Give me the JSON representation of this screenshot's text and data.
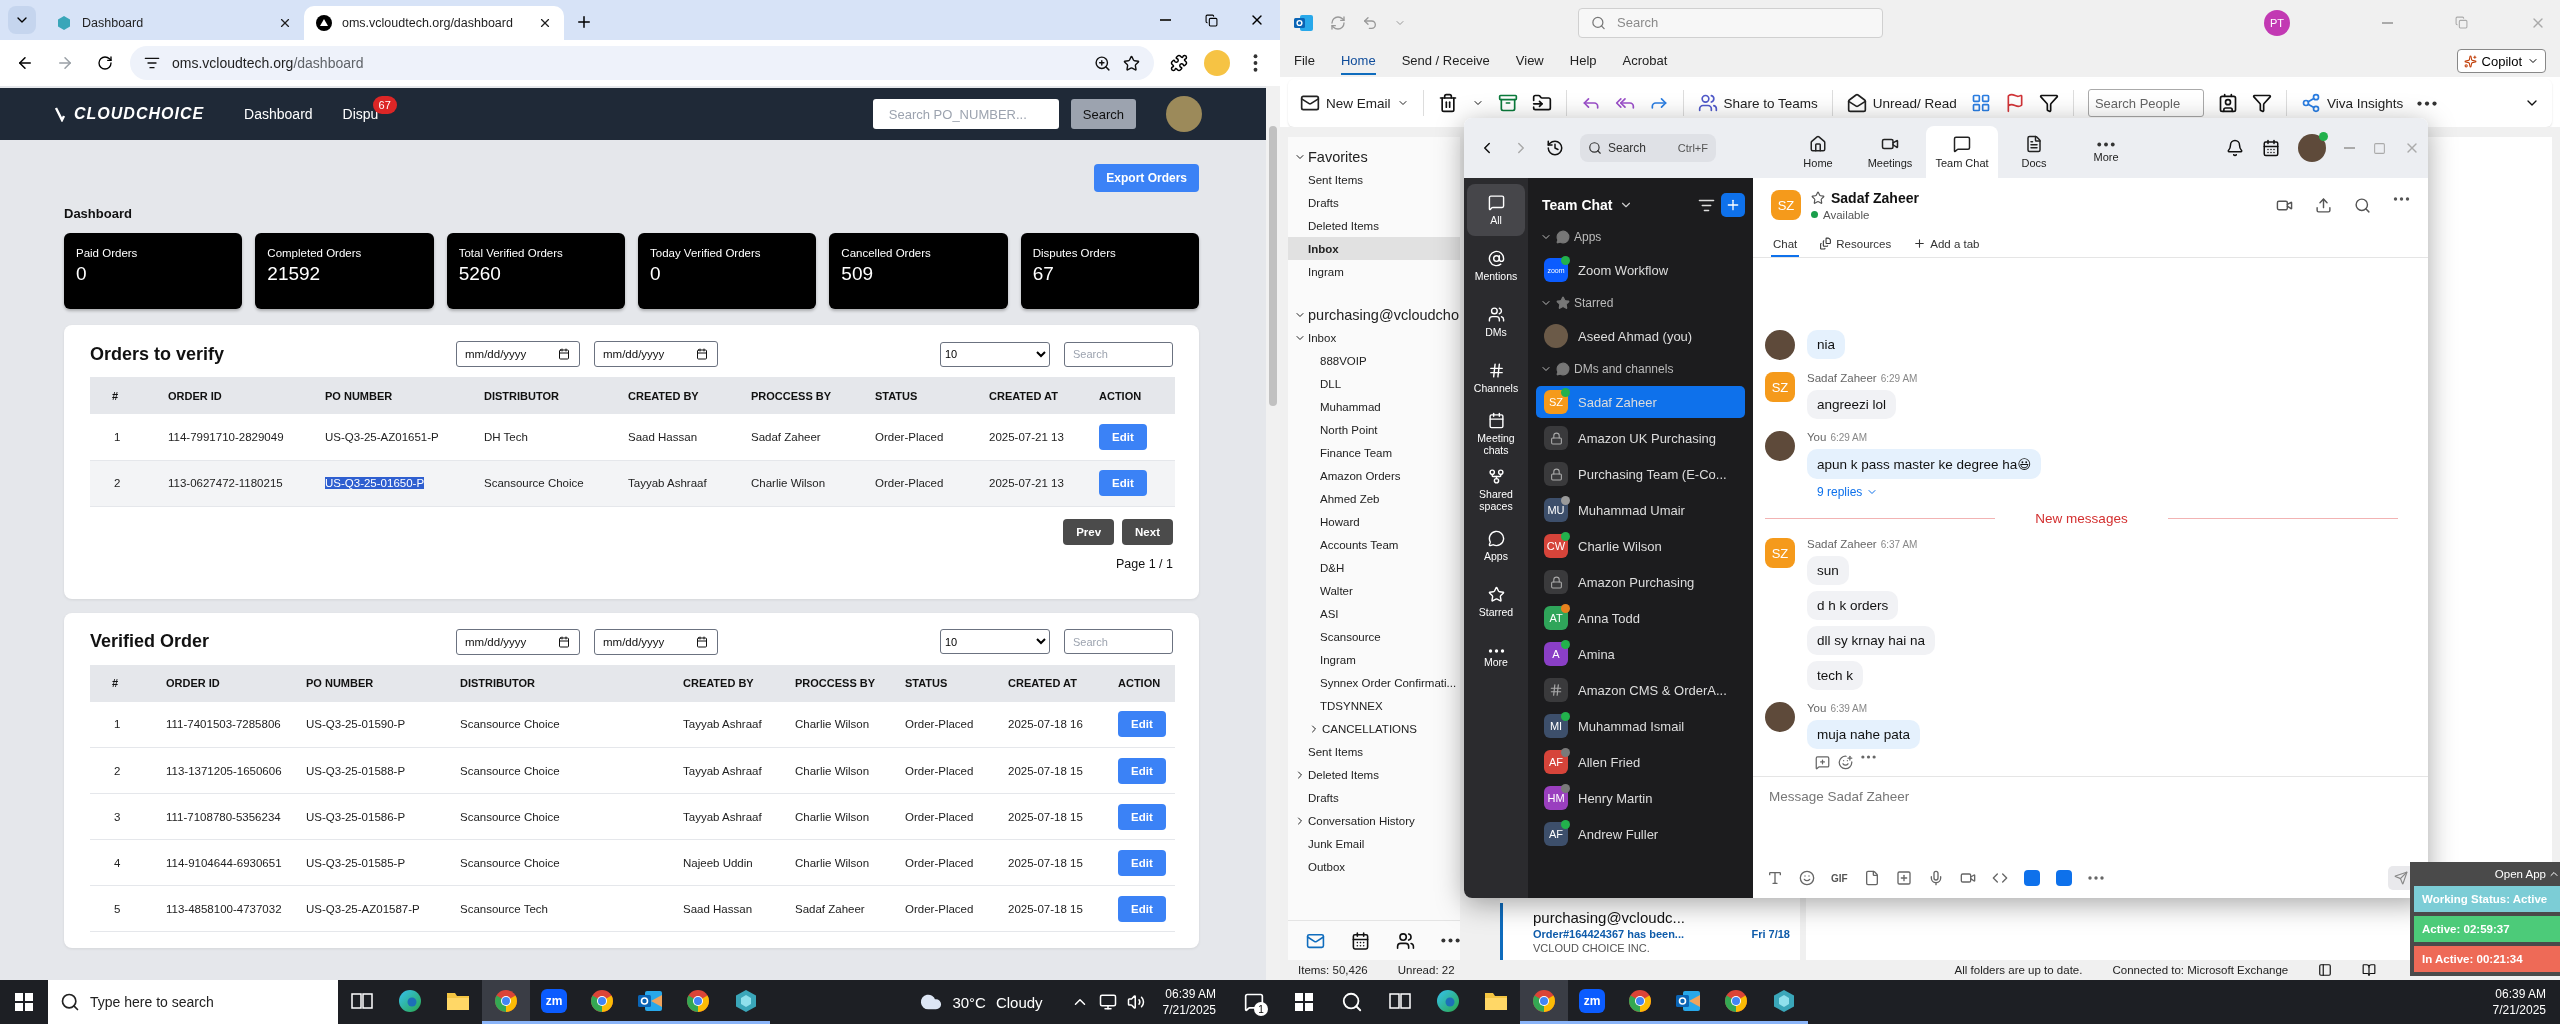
{
  "left_monitor": {
    "browser": {
      "tabs": [
        {
          "title": "Dashboard",
          "selected": false
        },
        {
          "title": "oms.vcloudtech.org/dashboard",
          "selected": true
        }
      ],
      "address": {
        "host": "oms.vcloudtech.org",
        "path": "/dashboard"
      }
    },
    "site": {
      "navbar": {
        "logo": "CLOUDCHOICE",
        "links": [
          {
            "label": "Dashboard"
          },
          {
            "label": "Dispu",
            "badge": "67"
          }
        ],
        "search_placeholder": "Search PO_NUMBER...",
        "search_button": "Search"
      },
      "export_button": "Export Orders",
      "heading": "Dashboard",
      "stats": [
        {
          "label": "Paid Orders",
          "value": "0"
        },
        {
          "label": "Completed Orders",
          "value": "21592"
        },
        {
          "label": "Total Verified Orders",
          "value": "5260"
        },
        {
          "label": "Today Verified Orders",
          "value": "0"
        },
        {
          "label": "Cancelled Orders",
          "value": "509"
        },
        {
          "label": "Disputes Orders",
          "value": "67"
        }
      ],
      "tables": [
        {
          "title": "Orders to verify",
          "date_placeholders": [
            "mm/dd/yyyy",
            "mm/dd/yyyy"
          ],
          "page_size": "10",
          "search_placeholder": "Search",
          "columns": [
            "#",
            "ORDER ID",
            "PO NUMBER",
            "DISTRIBUTOR",
            "CREATED BY",
            "PROCCESS BY",
            "STATUS",
            "CREATED AT",
            "ACTION"
          ],
          "rows": [
            {
              "cells": [
                "1",
                "114-7991710-2829049",
                "US-Q3-25-AZ01651-P",
                "DH Tech",
                "Saad Hassan",
                "Sadaf Zaheer",
                "Order-Placed",
                "2025-07-21 13"
              ],
              "action": "Edit",
              "po_highlighted": false
            },
            {
              "cells": [
                "2",
                "113-0627472-1180215",
                "US-Q3-25-01650-P",
                "Scansource Choice",
                "Tayyab Ashraaf",
                "Charlie Wilson",
                "Order-Placed",
                "2025-07-21 13"
              ],
              "action": "Edit",
              "po_highlighted": true
            }
          ],
          "pagination": {
            "prev": "Prev",
            "next": "Next",
            "page": "Page 1 / 1"
          }
        },
        {
          "title": "Verified Order",
          "date_placeholders": [
            "mm/dd/yyyy",
            "mm/dd/yyyy"
          ],
          "page_size": "10",
          "search_placeholder": "Search",
          "columns": [
            "#",
            "ORDER ID",
            "PO NUMBER",
            "DISTRIBUTOR",
            "CREATED BY",
            "PROCCESS BY",
            "STATUS",
            "CREATED AT",
            "ACTION"
          ],
          "rows": [
            {
              "cells": [
                "1",
                "111-7401503-7285806",
                "US-Q3-25-01590-P",
                "Scansource Choice",
                "Tayyab Ashraaf",
                "Charlie Wilson",
                "Order-Placed",
                "2025-07-18 16"
              ],
              "action": "Edit",
              "po_highlighted": false
            },
            {
              "cells": [
                "2",
                "113-1371205-1650606",
                "US-Q3-25-01588-P",
                "Scansource Choice",
                "Tayyab Ashraaf",
                "Charlie Wilson",
                "Order-Placed",
                "2025-07-18 15"
              ],
              "action": "Edit",
              "po_highlighted": false
            },
            {
              "cells": [
                "3",
                "111-7108780-5356234",
                "US-Q3-25-01586-P",
                "Scansource Choice",
                "Tayyab Ashraaf",
                "Charlie Wilson",
                "Order-Placed",
                "2025-07-18 15"
              ],
              "action": "Edit",
              "po_highlighted": false
            },
            {
              "cells": [
                "4",
                "114-9104644-6930651",
                "US-Q3-25-01585-P",
                "Scansource Choice",
                "Najeeb Uddin",
                "Charlie Wilson",
                "Order-Placed",
                "2025-07-18 15"
              ],
              "action": "Edit",
              "po_highlighted": false
            },
            {
              "cells": [
                "5",
                "113-4858100-4737032",
                "US-Q3-25-AZ01587-P",
                "Scansource Tech",
                "Saad Hassan",
                "Sadaf Zaheer",
                "Order-Placed",
                "2025-07-18 15"
              ],
              "action": "Edit",
              "po_highlighted": false
            }
          ]
        }
      ]
    },
    "taskbar": {
      "search_placeholder": "Type here to search",
      "apps": [
        {
          "kind": "taskview",
          "open": false,
          "focused": false
        },
        {
          "kind": "edge",
          "open": false,
          "focused": false
        },
        {
          "kind": "explorer",
          "open": false,
          "focused": false
        },
        {
          "kind": "chrome",
          "open": true,
          "focused": true
        },
        {
          "kind": "zoom",
          "label": "zm",
          "open": true,
          "focused": false
        },
        {
          "kind": "chrome",
          "open": true,
          "focused": false
        },
        {
          "kind": "outlook",
          "open": true,
          "focused": false
        },
        {
          "kind": "chrome",
          "open": true,
          "focused": false
        },
        {
          "kind": "hexagon",
          "open": true,
          "focused": false
        }
      ],
      "temperature": "30°C",
      "weather": "Cloudy",
      "time": "06:39 AM",
      "date": "7/21/2025",
      "notifications": "1"
    }
  },
  "right_monitor": {
    "outlook": {
      "search_placeholder": "Search",
      "account_initials": "PT",
      "menu": [
        {
          "label": "File",
          "selected": false
        },
        {
          "label": "Home",
          "selected": true
        },
        {
          "label": "Send / Receive",
          "selected": false
        },
        {
          "label": "View",
          "selected": false
        },
        {
          "label": "Help",
          "selected": false
        },
        {
          "label": "Acrobat",
          "selected": false
        }
      ],
      "copilot": "Copilot",
      "ribbon": {
        "new_email": "New Email",
        "share_to_teams": "Share to Teams",
        "unread_read": "Unread/ Read",
        "search_people_placeholder": "Search People",
        "viva_insights": "Viva Insights"
      },
      "folders": [
        {
          "label": "Favorites",
          "expanded": true,
          "selected": false,
          "children": [
            {
              "label": "Sent Items",
              "selected": false
            },
            {
              "label": "Drafts",
              "selected": false
            },
            {
              "label": "Deleted Items",
              "selected": false
            },
            {
              "label": "Inbox",
              "selected": true
            },
            {
              "label": "Ingram",
              "selected": false
            }
          ]
        },
        {
          "label": "purchasing@vcloudcho",
          "expanded": true,
          "selected": false,
          "children": [
            {
              "label": "Inbox",
              "expanded": true,
              "selected": false,
              "children": [
                {
                  "label": "888VOIP",
                  "selected": false
                },
                {
                  "label": "DLL",
                  "selected": false
                },
                {
                  "label": "Muhammad",
                  "selected": false
                },
                {
                  "label": "North Point",
                  "selected": false
                },
                {
                  "label": "Finance Team",
                  "selected": false
                },
                {
                  "label": "Amazon Orders",
                  "selected": false
                },
                {
                  "label": "Ahmed Zeb",
                  "selected": false
                },
                {
                  "label": "Howard",
                  "selected": false
                },
                {
                  "label": "Accounts Team",
                  "selected": false
                },
                {
                  "label": "D&H",
                  "selected": false
                },
                {
                  "label": "Walter",
                  "selected": false
                },
                {
                  "label": "ASI",
                  "selected": false
                },
                {
                  "label": "Scansource",
                  "selected": false
                },
                {
                  "label": "Ingram",
                  "selected": false
                },
                {
                  "label": "Synnex Order Confirmati...",
                  "selected": false
                },
                {
                  "label": "TDSYNNEX",
                  "selected": false
                },
                {
                  "label": "CANCELLATIONS",
                  "expanded": false,
                  "selected": false
                }
              ]
            },
            {
              "label": "Sent Items",
              "selected": false
            },
            {
              "label": "Deleted Items",
              "expanded": false,
              "selected": false
            },
            {
              "label": "Drafts",
              "selected": false
            },
            {
              "label": "Conversation History",
              "expanded": false,
              "selected": false
            },
            {
              "label": "Junk Email",
              "selected": false
            },
            {
              "label": "Outbox",
              "selected": false
            }
          ]
        }
      ],
      "message": {
        "sender": "purchasing@vcloudc...",
        "subject": "Order#164424367 has been...",
        "date": "Fri 7/18",
        "preview": "VCLOUD CHOICE INC."
      },
      "status": {
        "items": "Items: 50,426",
        "unread": "Unread: 22",
        "sync": "All folders are up to date.",
        "connection": "Connected to: Microsoft Exchange"
      }
    },
    "chat_app": {
      "search": "Search",
      "shortcut": "Ctrl+F",
      "nav": [
        {
          "label": "Home",
          "selected": false
        },
        {
          "label": "Meetings",
          "selected": false
        },
        {
          "label": "Team Chat",
          "selected": true
        },
        {
          "label": "Docs",
          "selected": false
        },
        {
          "label": "More",
          "selected": false
        }
      ],
      "rail": [
        {
          "label": "All",
          "selected": true
        },
        {
          "label": "Mentions",
          "selected": false
        },
        {
          "label": "DMs",
          "selected": false
        },
        {
          "label": "Channels",
          "selected": false
        },
        {
          "label": "Meeting chats",
          "selected": false
        },
        {
          "label": "Shared spaces",
          "selected": false
        },
        {
          "label": "Apps",
          "selected": false
        },
        {
          "label": "Starred",
          "selected": false
        },
        {
          "label": "More",
          "selected": false
        }
      ],
      "sidebar": {
        "title": "Team Chat",
        "sections": [
          {
            "label": "Apps",
            "expanded": true,
            "items": [
              {
                "kind": "app",
                "logo": "zoom",
                "name": "Zoom Workflow",
                "status": {
                  "color": "#22b14c"
                },
                "selected": false
              }
            ]
          },
          {
            "label": "Starred",
            "expanded": true,
            "items": [
              {
                "kind": "photo",
                "name": "Aseed Ahmad (you)",
                "selected": false
              }
            ]
          },
          {
            "label": "DMs and channels",
            "expanded": true,
            "items": [
              {
                "kind": "person",
                "initials": "SZ",
                "color": "#f59a1b",
                "name": "Sadaf Zaheer",
                "status": {
                  "color": "#22b14c"
                },
                "selected": true
              },
              {
                "kind": "private",
                "name": "Amazon UK Purchasing",
                "selected": false
              },
              {
                "kind": "private",
                "name": "Purchasing Team (E-Co...",
                "selected": false
              },
              {
                "kind": "person",
                "initials": "MU",
                "color": "#3d4f6b",
                "name": "Muhammad Umair",
                "status": {
                  "color": "#9a9a9a"
                },
                "selected": false
              },
              {
                "kind": "person",
                "initials": "CW",
                "color": "#d6443a",
                "name": "Charlie Wilson",
                "status": {
                  "color": "#22b14c"
                },
                "selected": false
              },
              {
                "kind": "private",
                "name": "Amazon Purchasing",
                "selected": false
              },
              {
                "kind": "person",
                "initials": "AT",
                "color": "#2fa55a",
                "name": "Anna Todd",
                "status": {
                  "color": "#e8821e"
                },
                "selected": false
              },
              {
                "kind": "person",
                "initials": "A",
                "color": "#8a3fc6",
                "name": "Amina",
                "status": {
                  "color": "#22b14c"
                },
                "selected": false
              },
              {
                "kind": "channel",
                "name": "Amazon CMS & OrderA...",
                "selected": false
              },
              {
                "kind": "person",
                "initials": "MI",
                "color": "#3d4f6b",
                "name": "Muhammad Ismail",
                "status": {
                  "color": "#22b14c"
                },
                "selected": false
              },
              {
                "kind": "person",
                "initials": "AF",
                "color": "#d6443a",
                "name": "Allen Fried",
                "status": {
                  "color": "#7a7a7a"
                },
                "selected": false
              },
              {
                "kind": "person",
                "initials": "HM",
                "color": "#9a3fbf",
                "name": "Henry Martin",
                "status": {
                  "color": "#7a7a7a"
                },
                "selected": false
              },
              {
                "kind": "person",
                "initials": "AF",
                "color": "#3d4f6b",
                "name": "Andrew Fuller",
                "status": {
                  "color": "#22b14c"
                },
                "selected": false
              }
            ]
          }
        ]
      },
      "conversation": {
        "initials": "SZ",
        "name": "Sadaf Zaheer",
        "presence": "Available",
        "tabs": [
          {
            "label": "Chat",
            "selected": true
          },
          {
            "label": "Resources",
            "selected": false
          },
          {
            "label": "Add a tab",
            "selected": false
          }
        ],
        "messages": [
          {
            "kind": "group",
            "mine": true,
            "bubbles": [
              "nia"
            ]
          },
          {
            "kind": "group",
            "mine": false,
            "initials": "SZ",
            "sender": "Sadaf Zaheer",
            "time": "6:29 AM",
            "bubbles": [
              "angreezi lol"
            ]
          },
          {
            "kind": "group",
            "mine": true,
            "sender": "You",
            "time": "6:29 AM",
            "bubbles": [
              "apun k pass master ke degree ha😃"
            ],
            "replies": "9 replies"
          },
          {
            "kind": "divider",
            "label": "New messages"
          },
          {
            "kind": "group",
            "mine": false,
            "initials": "SZ",
            "sender": "Sadaf Zaheer",
            "time": "6:37 AM",
            "bubbles": [
              "sun",
              "d h k orders",
              "dll sy krnay hai na",
              "tech k"
            ]
          },
          {
            "kind": "group",
            "mine": true,
            "sender": "You",
            "time": "6:39 AM",
            "bubbles": [
              "muja nahe pata"
            ],
            "reactions": true
          }
        ],
        "composer_placeholder": "Message Sadaf Zaheer",
        "gif": "GIF"
      }
    },
    "tracker": {
      "open": "Open App",
      "rows": [
        {
          "label": "Working Status: Active",
          "color": "#7ccdd6"
        },
        {
          "label": "Active: 02:59:37",
          "color": "#4ccb79"
        },
        {
          "label": "In Active: 00:21:34",
          "color": "#ee6a57"
        }
      ]
    },
    "taskbar": {
      "apps": [
        {
          "kind": "taskview",
          "open": false,
          "focused": false
        },
        {
          "kind": "edge",
          "open": false,
          "focused": false
        },
        {
          "kind": "explorer",
          "open": false,
          "focused": false
        },
        {
          "kind": "chrome",
          "open": true,
          "focused": true
        },
        {
          "kind": "zoom",
          "label": "zm",
          "open": true,
          "focused": false
        },
        {
          "kind": "chrome",
          "open": true,
          "focused": false
        },
        {
          "kind": "outlook",
          "open": true,
          "focused": false
        },
        {
          "kind": "chrome",
          "open": true,
          "focused": false
        },
        {
          "kind": "hexagon",
          "open": true,
          "focused": false
        }
      ],
      "time": "06:39 AM",
      "date": "7/21/2025"
    }
  }
}
